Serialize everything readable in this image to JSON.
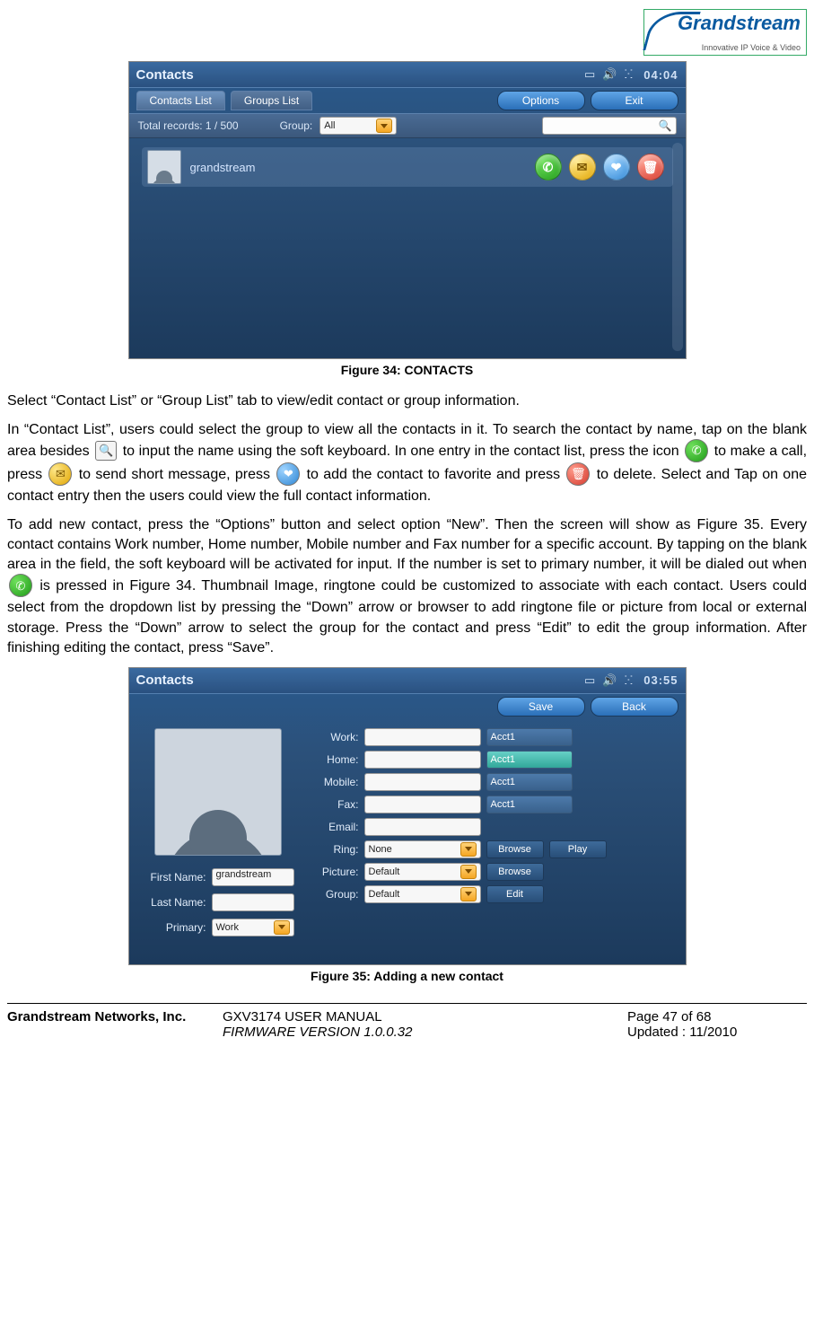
{
  "logo": {
    "brand": "Grandstream",
    "tagline": "Innovative IP Voice & Video"
  },
  "screenshot1": {
    "title": "Contacts",
    "clock": "04:04",
    "tabs": {
      "contacts": "Contacts List",
      "groups": "Groups List"
    },
    "buttons": {
      "options": "Options",
      "exit": "Exit"
    },
    "toolbar": {
      "records_label": "Total records: 1 / 500",
      "group_label": "Group:",
      "group_value": "All"
    },
    "row": {
      "name": "grandstream"
    }
  },
  "caption1": "Figure 34: CONTACTS",
  "para1": "Select “Contact List” or “Group List” tab to view/edit contact or group information.",
  "para2a": "In “Contact List”, users could select the group to view all the contacts in it. To search the contact by name, tap on the blank area besides",
  "para2b": "to input the name using the soft keyboard. In one entry in the contact list, press the icon",
  "para2c": "to make a call, press",
  "para2d": "to send short message, press",
  "para2e": "to add the contact to favorite and press",
  "para2f": "to delete. Select and Tap on one contact entry then the users could view the full contact information.",
  "para3a": "To add new contact, press the “Options” button and select option “New”. Then the screen will show as Figure 35. Every contact contains Work number, Home number, Mobile number and Fax number for a specific account. By tapping on the blank area in the field, the soft keyboard will be activated for input. If the number is set to primary number, it will be dialed out when",
  "para3b": "is pressed in Figure 34. Thumbnail Image, ringtone could be customized to associate with each contact. Users could select from the dropdown list by pressing the “Down” arrow or browser to add ringtone file or picture from local or external storage. Press the “Down” arrow to select the group for the contact and press “Edit” to edit the group information. After finishing editing the contact, press “Save”.",
  "screenshot2": {
    "title": "Contacts",
    "clock": "03:55",
    "buttons": {
      "save": "Save",
      "back": "Back"
    },
    "left": {
      "first_name_label": "First Name:",
      "first_name_value": "grandstream",
      "last_name_label": "Last Name:",
      "last_name_value": "",
      "primary_label": "Primary:",
      "primary_value": "Work"
    },
    "right": {
      "labels": {
        "work": "Work:",
        "home": "Home:",
        "mobile": "Mobile:",
        "fax": "Fax:",
        "email": "Email:",
        "ring": "Ring:",
        "picture": "Picture:",
        "group": "Group:"
      },
      "acct": "Acct1",
      "ring_value": "None",
      "picture_value": "Default",
      "group_value": "Default",
      "btn_browse": "Browse",
      "btn_play": "Play",
      "btn_edit": "Edit"
    }
  },
  "caption2": "Figure 35: Adding a new contact",
  "footer": {
    "company": "Grandstream Networks, Inc.",
    "manual": "GXV3174 USER MANUAL",
    "page": "Page 47 of 68",
    "firmware": "FIRMWARE VERSION 1.0.0.32",
    "updated": "Updated : 11/2010"
  }
}
